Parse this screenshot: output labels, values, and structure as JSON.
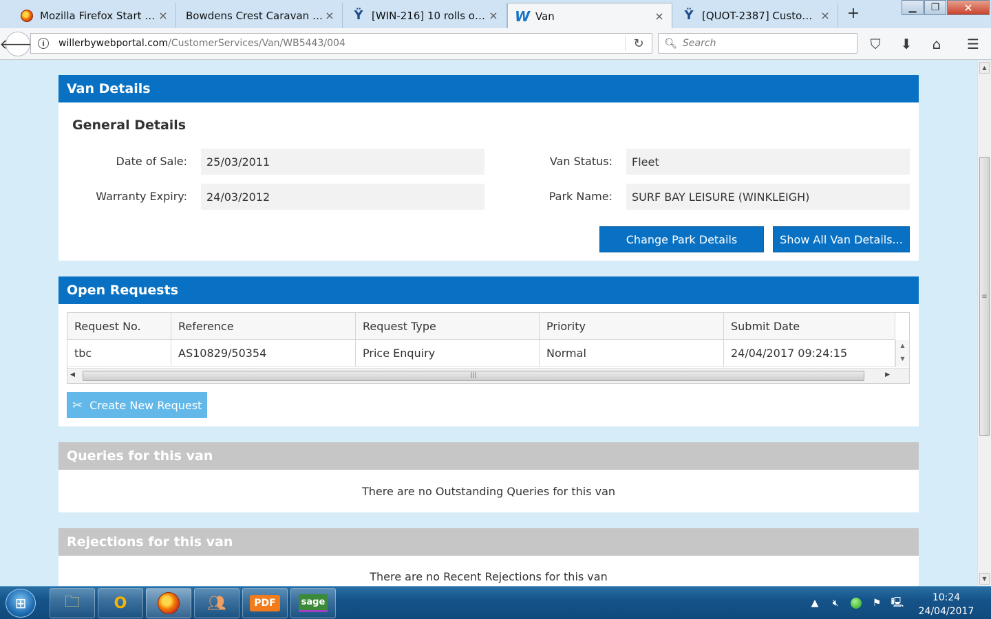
{
  "browser": {
    "tabs": [
      {
        "label": "Mozilla Firefox Start Pa...",
        "icon": "firefox-icon"
      },
      {
        "label": "Bowdens Crest Caravan and...",
        "icon": "none"
      },
      {
        "label": "[WIN-216] 10 rolls of th...",
        "icon": "jira-icon"
      },
      {
        "label": "Van",
        "icon": "willerby-icon"
      },
      {
        "label": "[QUOT-2387] Customer...",
        "icon": "jira-icon"
      }
    ],
    "tab_close_glyph": "×",
    "new_tab_glyph": "+",
    "url_host": "willerbywebportal.com",
    "url_path": "/CustomerServices/Van/WB5443/004",
    "search_placeholder": "Search"
  },
  "van_details": {
    "header": "Van Details",
    "subtitle": "General Details",
    "date_of_sale_label": "Date of Sale:",
    "date_of_sale": "25/03/2011",
    "warranty_expiry_label": "Warranty Expiry:",
    "warranty_expiry": "24/03/2012",
    "van_status_label": "Van Status:",
    "van_status": "Fleet",
    "park_name_label": "Park Name:",
    "park_name": "SURF BAY LEISURE (WINKLEIGH)",
    "change_park_button": "Change Park Details",
    "show_all_button": "Show All Van Details..."
  },
  "open_requests": {
    "header": "Open Requests",
    "columns": [
      "Request No.",
      "Reference",
      "Request Type",
      "Priority",
      "Submit Date"
    ],
    "rows": [
      [
        "tbc",
        "AS10829/50354",
        "Price Enquiry",
        "Normal",
        "24/04/2017 09:24:15"
      ]
    ],
    "create_button": "Create New Request"
  },
  "queries": {
    "header": "Queries for this van",
    "message": "There are no Outstanding Queries for this van"
  },
  "rejections": {
    "header": "Rejections for this van",
    "message": "There are no Recent Rejections for this van"
  },
  "taskbar": {
    "time": "10:24",
    "date": "24/04/2017"
  },
  "colors": {
    "panel_header_blue": "#0971c3",
    "panel_header_grey": "#c6c6c6",
    "page_background": "#d6ecf8",
    "create_button_light_blue": "#62b8e8"
  }
}
